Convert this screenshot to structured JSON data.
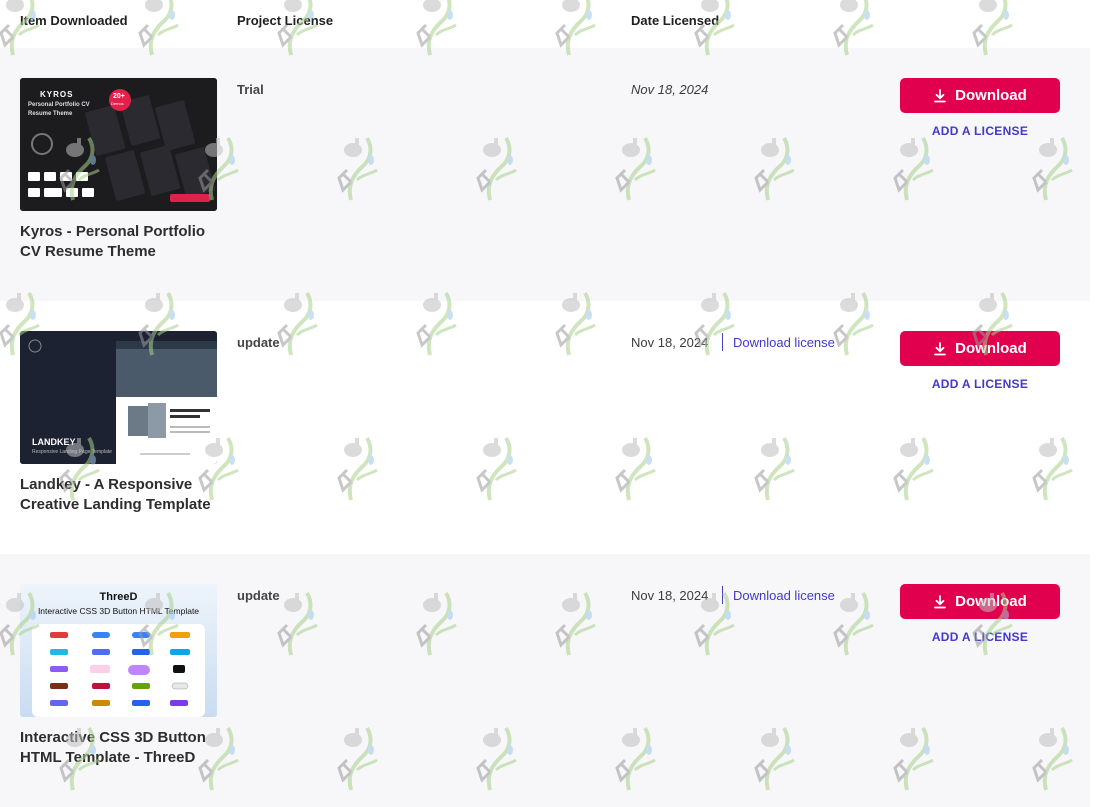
{
  "header": {
    "item": "Item Downloaded",
    "license": "Project License",
    "date": "Date Licensed"
  },
  "rows": [
    {
      "title": "Kyros - Personal Portfolio CV Resume Theme",
      "license": "Trial",
      "date": "Nov 18, 2024",
      "download_label": "Download",
      "add_license_label": "ADD A LICENSE",
      "thumb": {
        "heading": "KYROS",
        "sub1": "Personal Portfolio CV",
        "sub2": "Resume Theme",
        "badge": "20+",
        "badge_sub": "Demos",
        "colors": {
          "bg": "#1c1c1f",
          "accent": "#e0224b"
        }
      }
    },
    {
      "title": "Landkey - A Responsive Creative Landing Template",
      "license": "update",
      "date": "Nov 18, 2024",
      "download_license": "Download license",
      "download_label": "Download",
      "add_license_label": "ADD A LICENSE",
      "thumb": {
        "heading": "LANDKEY",
        "sub": "Responsive Landing Page Template",
        "colors": {
          "bg": "#1d2233"
        }
      }
    },
    {
      "title": "Interactive CSS 3D Button HTML Template - ThreeD",
      "license": "update",
      "date": "Nov 18, 2024",
      "download_license": "Download license",
      "download_label": "Download",
      "add_license_label": "ADD A LICENSE",
      "thumb": {
        "heading": "ThreeD",
        "sub": "Interactive CSS 3D Button HTML Template",
        "colors": {
          "bg": "#dbe8f6"
        }
      }
    }
  ],
  "colors": {
    "button": "#e0004d",
    "link": "#4338ca",
    "row_shade": "#f7f7fa"
  },
  "icons": [
    "download-icon",
    "watermark-icon"
  ]
}
